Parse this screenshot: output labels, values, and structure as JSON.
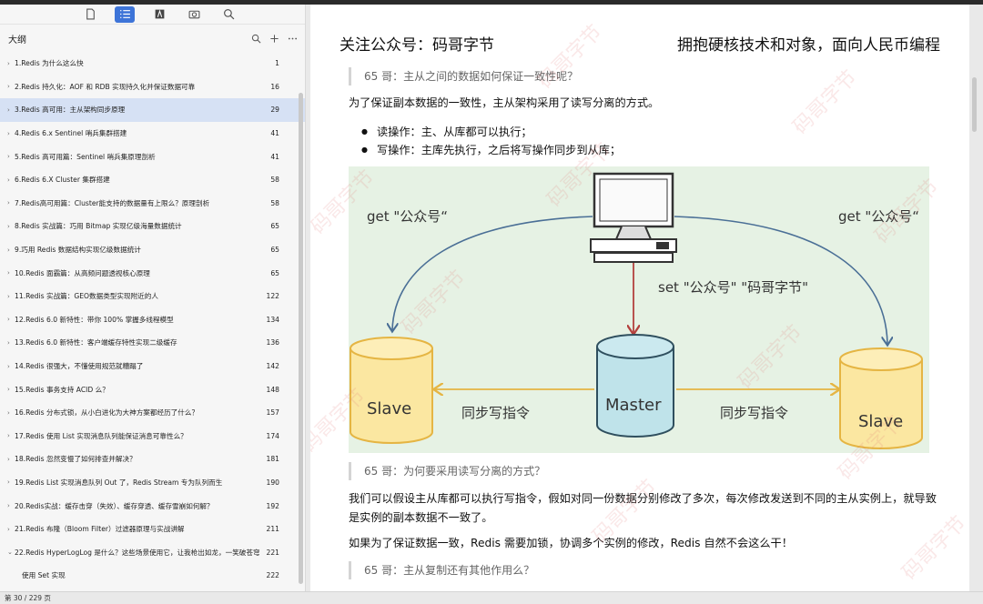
{
  "toolbar": {
    "buttons": [
      "page-view",
      "outline-view",
      "annotation-view",
      "snapshot",
      "search"
    ]
  },
  "outline": {
    "title": "大纲",
    "items": [
      {
        "label": "1.Redis 为什么这么快",
        "page": "1"
      },
      {
        "label": "2.Redis 持久化：AOF 和 RDB 实现持久化并保证数据可靠",
        "page": "16"
      },
      {
        "label": "3.Redis 高可用：主从架构同步原理",
        "page": "29"
      },
      {
        "label": "4.Redis 6.x Sentinel 哨兵集群搭建",
        "page": "41"
      },
      {
        "label": "5.Redis 高可用篇：Sentinel 哨兵集原理剖析",
        "page": "41"
      },
      {
        "label": "6.Redis 6.X Cluster 集群搭建",
        "page": "58"
      },
      {
        "label": "7.Redis高可用篇：Cluster能支持的数据量有上限么？原理剖析",
        "page": "58"
      },
      {
        "label": "8.Redis 实战篇：巧用 Bitmap 实现亿级海量数据统计",
        "page": "65"
      },
      {
        "label": "9.巧用 Redis 数据结构实现亿级数据统计",
        "page": "65"
      },
      {
        "label": "10.Redis 面霸篇：从高频问题透视核心原理",
        "page": "65"
      },
      {
        "label": "11.Redis 实战篇：GEO数据类型实现附近的人",
        "page": "122"
      },
      {
        "label": "12.Redis 6.0 新特性：带你 100% 掌握多线程模型",
        "page": "134"
      },
      {
        "label": "13.Redis 6.0 新特性：客户端缓存特性实现二级缓存",
        "page": "136"
      },
      {
        "label": "14.Redis 很强大，不懂使用规范就糟蹋了",
        "page": "142"
      },
      {
        "label": "15.Redis 事务支持 ACID 么？",
        "page": "148"
      },
      {
        "label": "16.Redis 分布式锁，从小白进化为大神方案都经历了什么？",
        "page": "157"
      },
      {
        "label": "17.Redis 使用 List 实现消息队列能保证消息可靠性么？",
        "page": "174"
      },
      {
        "label": "18.Redis 忽然变慢了如何排查并解决？",
        "page": "181"
      },
      {
        "label": "19.Redis List 实现消息队列 Out 了，Redis Stream 专为队列而生",
        "page": "190"
      },
      {
        "label": "20.Redis实战：缓存击穿（失效）、缓存穿透、缓存雪崩如何解？",
        "page": "192"
      },
      {
        "label": "21.Redis 布隆（Bloom Filter）过滤器原理与实战讲解",
        "page": "211"
      },
      {
        "label": "22.Redis HyperLogLog 是什么？这些场景使用它，让我枪出如龙，一笑破苍穹",
        "page": "221"
      }
    ],
    "sub_item": {
      "label": "使用 Set 实现",
      "page": "222"
    }
  },
  "status": {
    "page_info": "第 30 / 229 页"
  },
  "doc": {
    "header_left": "关注公众号：码哥字节",
    "header_right": "拥抱硬核技术和对象，面向人民币编程",
    "quote1": "65 哥：主从之间的数据如何保证一致性呢？",
    "para1": "为了保证副本数据的一致性，主从架构采用了读写分离的方式。",
    "bullet1": "读操作：主、从库都可以执行；",
    "bullet2": "写操作：主库先执行，之后将写操作同步到从库；",
    "quote2": "65 哥：为何要采用读写分离的方式？",
    "para2": "我们可以假设主从库都可以执行写指令，假如对同一份数据分别修改了多次，每次修改发送到不同的主从实例上，就导致是实例的副本数据不一致了。",
    "para3": "如果为了保证数据一致，Redis 需要加锁，协调多个实例的修改，Redis 自然不会这么干！",
    "quote3": "65 哥：主从复制还有其他作用么？",
    "watermark": "码哥字节"
  },
  "diagram": {
    "get_left": "get \"公众号“",
    "get_right": "get \"公众号“",
    "set_cmd": "set \"公众号\" \"码哥字节\"",
    "master": "Master",
    "slave_left": "Slave",
    "slave_right": "Slave",
    "sync_left": "同步写指令",
    "sync_right": "同步写指令"
  },
  "colors": {
    "selected_row": "#d6e1f4",
    "accent": "#3d74d8",
    "figure_bg": "#e6f2e4",
    "slave_fill": "#fbe7a1",
    "master_fill": "#bfe3ea",
    "arrow_blue": "#4a6f96",
    "arrow_red": "#b3413e",
    "arrow_yellow": "#e5b543"
  }
}
